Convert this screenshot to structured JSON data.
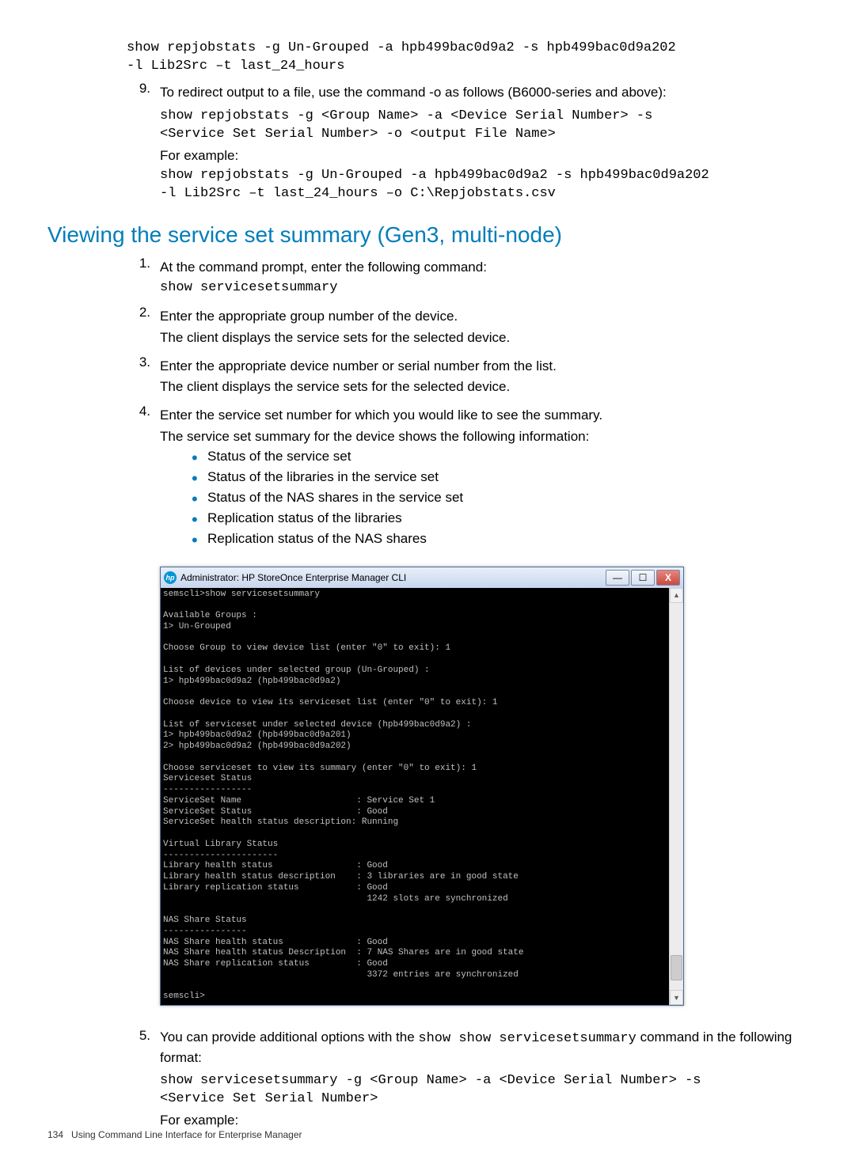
{
  "top": {
    "code1": "show repjobstats -g Un-Grouped -a hpb499bac0d9a2 -s hpb499bac0d9a202\n-l Lib2Src –t last_24_hours",
    "item9_num": "9.",
    "item9_text": "To redirect output to a file, use the command -o as follows (B6000-series and above):",
    "code2": "show repjobstats -g <Group Name> -a <Device Serial Number> -s\n<Service Set Serial Number> -o <output File Name>",
    "for_example": "For example:",
    "code3": "show repjobstats -g Un-Grouped -a hpb499bac0d9a2 -s hpb499bac0d9a202\n-l Lib2Src –t last_24_hours –o C:\\Repjobstats.csv"
  },
  "section_heading": "Viewing the service set summary (Gen3, multi-node)",
  "steps": [
    {
      "num": "1.",
      "lines": [
        {
          "t": "body",
          "v": "At the command prompt, enter the following command:"
        },
        {
          "t": "mono",
          "v": "show servicesetsummary"
        }
      ]
    },
    {
      "num": "2.",
      "lines": [
        {
          "t": "body",
          "v": "Enter the appropriate group number of the device."
        },
        {
          "t": "body",
          "v": "The client displays the service sets for the selected device."
        }
      ]
    },
    {
      "num": "3.",
      "lines": [
        {
          "t": "body",
          "v": "Enter the appropriate device number or serial number from the list."
        },
        {
          "t": "body",
          "v": "The client displays the service sets for the selected device."
        }
      ]
    },
    {
      "num": "4.",
      "lines": [
        {
          "t": "body",
          "v": "Enter the service set number for which you would like to see the summary."
        },
        {
          "t": "body",
          "v": "The service set summary for the device shows the following information:"
        }
      ],
      "bullets": [
        "Status of the service set",
        "Status of the libraries in the service set",
        "Status of the NAS shares in the service set",
        "Replication status of the libraries",
        "Replication status of the NAS shares"
      ]
    }
  ],
  "cli": {
    "title": "Administrator: HP StoreOnce Enterprise Manager CLI",
    "content": "semscli>show servicesetsummary\n\nAvailable Groups :\n1> Un-Grouped\n\nChoose Group to view device list (enter \"0\" to exit): 1\n\nList of devices under selected group (Un-Grouped) :\n1> hpb499bac0d9a2 (hpb499bac0d9a2)\n\nChoose device to view its serviceset list (enter \"0\" to exit): 1\n\nList of serviceset under selected device (hpb499bac0d9a2) :\n1> hpb499bac0d9a2 (hpb499bac0d9a201)\n2> hpb499bac0d9a2 (hpb499bac0d9a202)\n\nChoose serviceset to view its summary (enter \"0\" to exit): 1\nServiceset Status\n-----------------\nServiceSet Name                      : Service Set 1\nServiceSet Status                    : Good\nServiceSet health status description: Running\n\nVirtual Library Status\n----------------------\nLibrary health status                : Good\nLibrary health status description    : 3 libraries are in good state\nLibrary replication status           : Good\n                                       1242 slots are synchronized\n\nNAS Share Status\n----------------\nNAS Share health status              : Good\nNAS Share health status Description  : 7 NAS Shares are in good state\nNAS Share replication status         : Good\n                                       3372 entries are synchronized\n\nsemscli>"
  },
  "step5": {
    "num": "5.",
    "text_prefix": "You can provide additional options with the ",
    "mono_inline": "show show servicesetsummary",
    "text_suffix": " command in the following format:",
    "code": "show servicesetsummary -g <Group Name> -a <Device Serial Number> -s\n<Service Set Serial Number>",
    "for_example": "For example:"
  },
  "footer": {
    "page_num": "134",
    "chapter": "Using Command Line Interface for Enterprise Manager"
  }
}
